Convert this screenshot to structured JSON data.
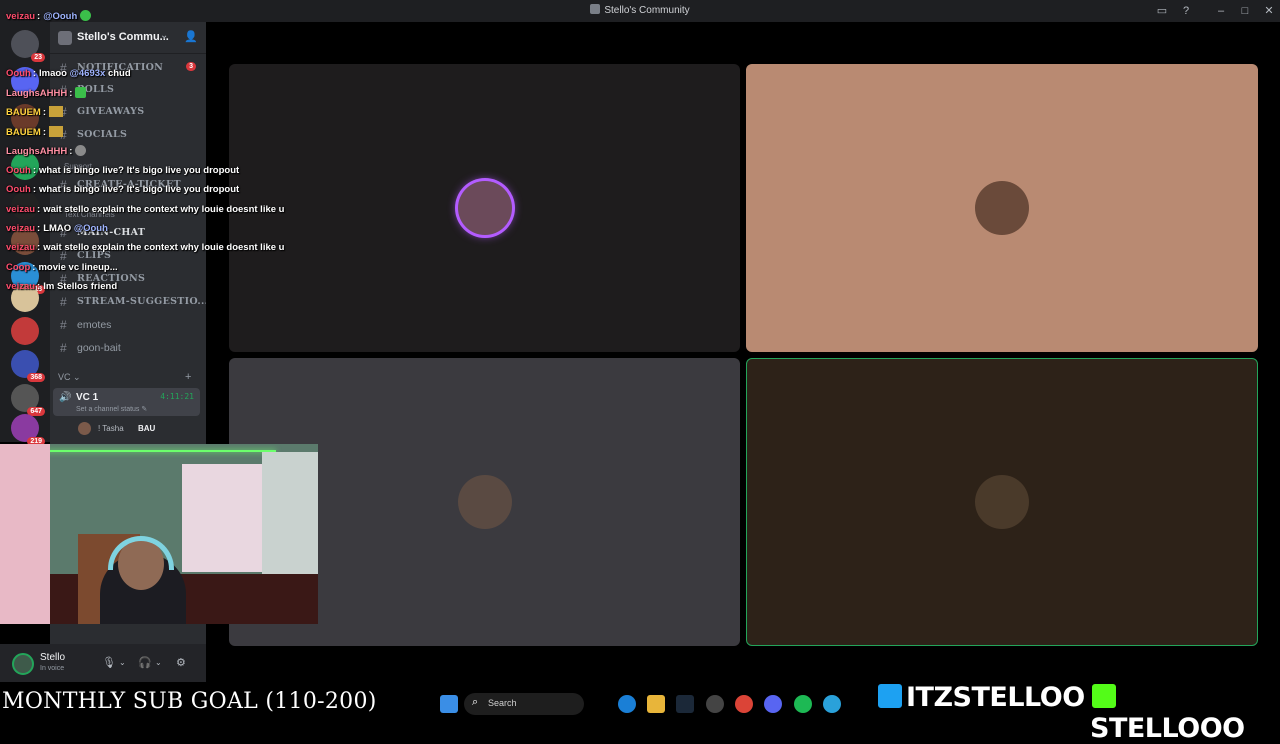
{
  "window": {
    "title": "Stello's Community"
  },
  "server_list": {
    "badges": [
      "23",
      "313",
      "368",
      "647",
      "219"
    ]
  },
  "guild": {
    "name": "Stello's Commu..."
  },
  "channels": [
    {
      "name": "NOTIFICATION",
      "badge": "3",
      "caps": true
    },
    {
      "name": "POLLS",
      "caps": true
    },
    {
      "name": "GIVEAWAYS",
      "caps": true
    },
    {
      "name": "SOCIALS",
      "caps": true
    },
    {
      "name": "CREATE-A-TICKET",
      "caps": true
    },
    {
      "name": "MAIN-CHAT",
      "caps": true
    },
    {
      "name": "CLIPS",
      "caps": true
    },
    {
      "name": "REACTIONS",
      "caps": true
    },
    {
      "name": "STREAM-SUGGESTIO...",
      "caps": true
    },
    {
      "name": "emotes",
      "caps": false
    },
    {
      "name": "goon-bait",
      "caps": false
    }
  ],
  "categories": {
    "support": "Support",
    "text_channels": "Text Channels",
    "vc": "VC ⌄"
  },
  "voice": {
    "channel": "VC 1",
    "duration": "4:11:21",
    "status": "Set a channel status ✎",
    "user": "! Tasha",
    "user_tag": "BAU"
  },
  "user_panel": {
    "name": "Stello",
    "status": "In voice"
  },
  "chat": [
    {
      "user": "veizau",
      "color": "#ff4d6d",
      "text": "",
      "mention": "@Oouh",
      "emote": "green"
    },
    {
      "user": "Oouh",
      "color": "#ff4d6d",
      "text": "lmaoo",
      "mention": "@4693x",
      "suffix": "chud"
    },
    {
      "user": "LaughsAHHH",
      "color": "#ff8fa3",
      "text": "",
      "emote": "green"
    },
    {
      "user": "BAUEM",
      "color": "#ffd23f",
      "text": "",
      "emote": "gold"
    },
    {
      "user": "BAUEM",
      "color": "#ffd23f",
      "text": "",
      "emote": "gold"
    },
    {
      "user": "LaughsAHHH",
      "color": "#ff8fa3",
      "text": "",
      "emote": "grey"
    },
    {
      "user": "Oouh",
      "color": "#ff4d6d",
      "text": "what is bingo live? It's bigo live you dropout"
    },
    {
      "user": "Oouh",
      "color": "#ff4d6d",
      "text": "what is bingo live? It's bigo live you dropout"
    },
    {
      "user": "veizau",
      "color": "#ff4d6d",
      "text": "wait stello explain the context why louie doesnt like u"
    },
    {
      "user": "veizau",
      "color": "#ff4d6d",
      "text": "LMAO",
      "mention": "@Oouh"
    },
    {
      "user": "veizau",
      "color": "#ff4d6d",
      "text": "wait stello explain the context why louie doesnt like u"
    },
    {
      "user": "Coop",
      "color": "#ff4d6d",
      "text": "movie vc lineup..."
    },
    {
      "user": "veizau",
      "color": "#ff4d6d",
      "text": "Im Stellos friend"
    }
  ],
  "overlay": {
    "subgoal": "MONTHLY SUB GOAL (110-200)",
    "twitter": "ITZSTELLOO",
    "kick": "STELLOOO"
  },
  "taskbar": {
    "search": "Search"
  },
  "colors": {
    "speaking_ring": "#b35cff",
    "voice_green": "#23a55a",
    "mention": "#da373c"
  }
}
